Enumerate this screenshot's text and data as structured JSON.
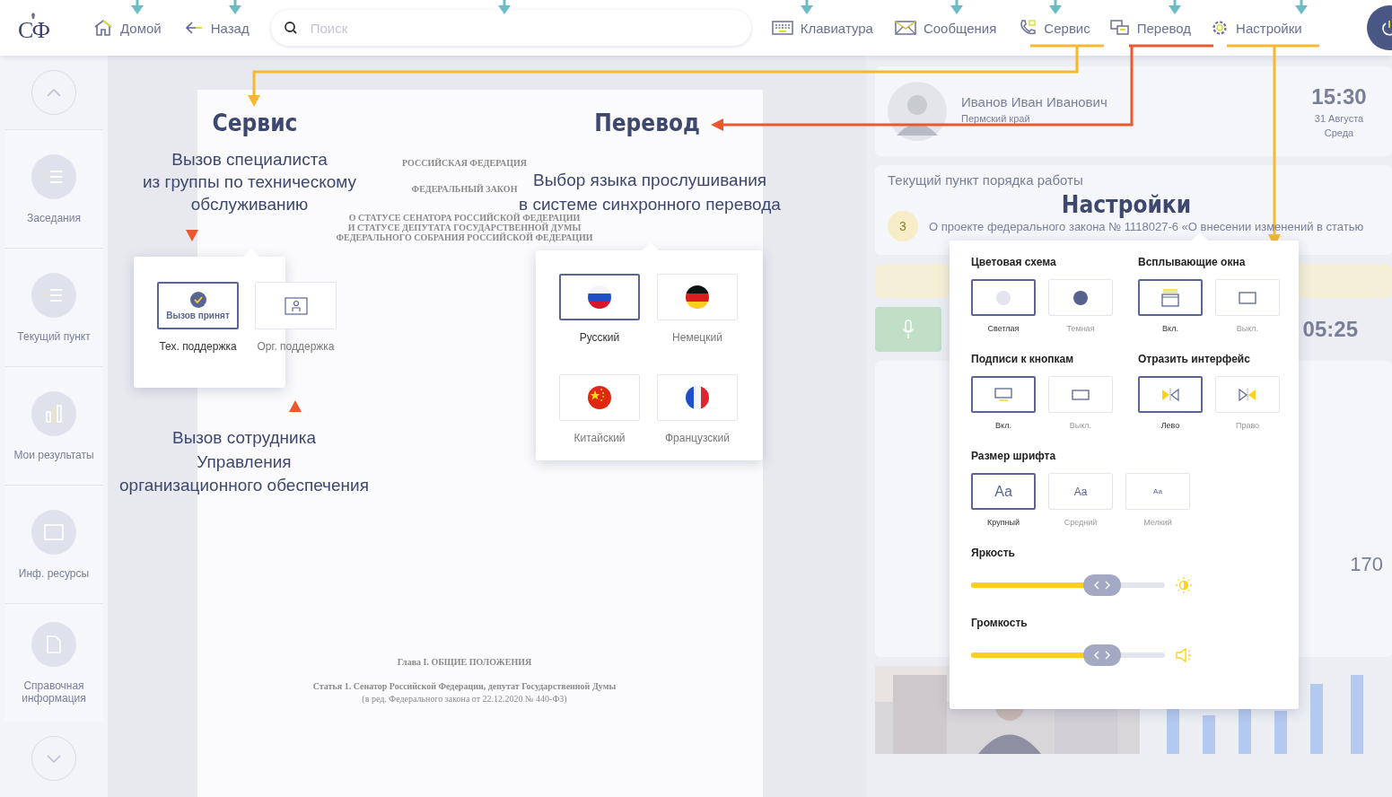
{
  "top_bar": {
    "logo": "СФ",
    "nav_left": [
      {
        "label": "Домой",
        "kind": "home"
      },
      {
        "label": "Назад",
        "kind": "back"
      }
    ],
    "search": {
      "placeholder": "Поиск"
    },
    "nav_right": [
      {
        "label": "Клавиатура",
        "kind": "keyboard"
      },
      {
        "label": "Сообщения",
        "kind": "mail"
      },
      {
        "label": "Сервис",
        "kind": "phone"
      },
      {
        "label": "Перевод",
        "kind": "translate"
      },
      {
        "label": "Настройки",
        "kind": "gear"
      }
    ]
  },
  "sidebar": {
    "items": [
      {
        "label": "Заседания",
        "kind": "list"
      },
      {
        "label": "Текущий пункт",
        "kind": "list"
      },
      {
        "label": "Мои результаты",
        "kind": "chart"
      },
      {
        "label": "Инф. ресурсы",
        "kind": "window"
      },
      {
        "label": "Справочная информация",
        "kind": "doc"
      }
    ]
  },
  "document": {
    "heading_lines": [
      "РОССИЙСКАЯ ФЕДЕРАЦИЯ",
      "ФЕДЕРАЛЬНЫЙ ЗАКОН",
      "О СТАТУСЕ СЕНАТОРА РОССИЙСКОЙ ФЕДЕРАЦИИ",
      "И СТАТУСЕ ДЕПУТАТА ГОСУДАРСТВЕННОЙ ДУМЫ",
      "ФЕДЕРАЛЬНОГО СОБРАНИЯ РОССИЙСКОЙ ФЕДЕРАЦИИ"
    ],
    "chapter": "Глава I. ОБЩИЕ ПОЛОЖЕНИЯ",
    "article": "Статья 1. Сенатор Российской Федерации, депутат Государственной Думы",
    "article_note": "(в ред. Федерального закона от 22.12.2020 № 440-ФЗ)"
  },
  "dashboard": {
    "user": {
      "name": "Иванов Иван Иванович",
      "region": "Пермский край"
    },
    "clock": {
      "time": "15:30",
      "date": "31 Августа",
      "weekday": "Среда"
    },
    "agenda": {
      "title": "Текущий пункт порядка работы",
      "number": "3",
      "text": "О проекте федерального закона № 1118027-6 «О внесении изменений в статью"
    },
    "conference": {
      "timer": "05:25"
    },
    "results": {
      "total": "170"
    }
  },
  "callouts": {
    "service": {
      "title": "Сервис",
      "description": "Вызов специалиста\nиз группы по техническому\nобслуживанию",
      "options": [
        {
          "label": "Тех. поддержка",
          "status": "Вызов принят",
          "kind": "check",
          "selected": true
        },
        {
          "label": "Орг. поддержка",
          "kind": "person",
          "selected": false
        }
      ],
      "note": "Вызов сотрудника\nУправления\nорганизационного обеспечения"
    },
    "translation": {
      "title": "Перевод",
      "description": "Выбор языка прослушивания\nв системе синхронного перевода",
      "languages": [
        {
          "label": "Русский",
          "kind": "ru",
          "selected": true
        },
        {
          "label": "Немецкий",
          "kind": "de",
          "selected": false
        },
        {
          "label": "Китайский",
          "kind": "cn",
          "selected": false
        },
        {
          "label": "Французский",
          "kind": "fr",
          "selected": false
        }
      ]
    },
    "settings": {
      "title": "Настройки",
      "groups": [
        {
          "title": "Цветовая схема",
          "options": [
            {
              "label": "Светлая",
              "kind": "light",
              "selected": true
            },
            {
              "label": "Темная",
              "kind": "dark",
              "selected": false
            }
          ]
        },
        {
          "title": "Всплывающие окна",
          "options": [
            {
              "label": "Вкл.",
              "kind": "popup-on",
              "selected": true
            },
            {
              "label": "Выкл.",
              "kind": "popup-off",
              "selected": false
            }
          ]
        },
        {
          "title": "Подписи к кнопкам",
          "options": [
            {
              "label": "Вкл.",
              "kind": "caption-on",
              "selected": true
            },
            {
              "label": "Выкл.",
              "kind": "caption-off",
              "selected": false
            }
          ]
        },
        {
          "title": "Отразить интерфейс",
          "options": [
            {
              "label": "Лево",
              "kind": "mirror-left",
              "selected": true
            },
            {
              "label": "Право",
              "kind": "mirror-right",
              "selected": false
            }
          ]
        },
        {
          "title": "Размер шрифта",
          "options": [
            {
              "label": "Крупный",
              "sample": "Aa",
              "kind": "font-large",
              "selected": true
            },
            {
              "label": "Средний",
              "sample": "Aa",
              "kind": "font-medium",
              "selected": false
            },
            {
              "label": "Мелкий",
              "sample": "Aa",
              "kind": "font-small",
              "selected": false
            }
          ]
        }
      ],
      "sliders": [
        {
          "label": "Яркость",
          "kind": "brightness",
          "level": 0.73
        },
        {
          "label": "Громкость",
          "kind": "volume",
          "level": 0.73
        }
      ]
    }
  }
}
